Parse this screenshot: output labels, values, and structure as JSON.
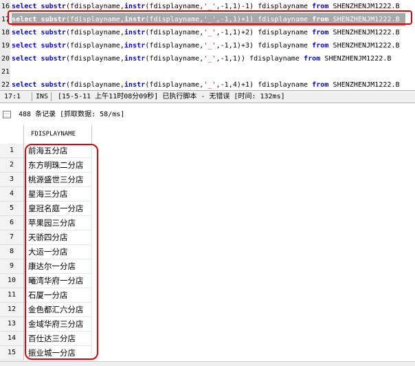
{
  "editor": {
    "lines": [
      {
        "num": "16",
        "selected": false,
        "tokens": [
          [
            "kw",
            "select"
          ],
          [
            "t",
            " "
          ],
          [
            "kw",
            "substr"
          ],
          [
            "t",
            "(fdisplayname,"
          ],
          [
            "kw",
            "instr"
          ],
          [
            "t",
            "(fdisplayname,"
          ],
          [
            "str",
            "'_'"
          ],
          [
            "t",
            ",-1,1)-1) fdisplayname "
          ],
          [
            "kw",
            "from"
          ],
          [
            "t",
            " SHENZHENJM1222.B"
          ]
        ]
      },
      {
        "num": "17",
        "selected": true,
        "tokens": [
          [
            "kw",
            "select"
          ],
          [
            "t",
            " "
          ],
          [
            "kw",
            "substr"
          ],
          [
            "t",
            "(fdisplayname,"
          ],
          [
            "kw",
            "instr"
          ],
          [
            "t",
            "(fdisplayname,"
          ],
          [
            "str",
            "'_'"
          ],
          [
            "t",
            ",-1,1)+1) fdisplayname "
          ],
          [
            "kw",
            "from"
          ],
          [
            "t",
            " SHENZHENJM1222.B"
          ]
        ]
      },
      {
        "num": "18",
        "selected": false,
        "tokens": [
          [
            "kw",
            "select"
          ],
          [
            "t",
            " "
          ],
          [
            "kw",
            "substr"
          ],
          [
            "t",
            "(fdisplayname,"
          ],
          [
            "kw",
            "instr"
          ],
          [
            "t",
            "(fdisplayname,"
          ],
          [
            "str",
            "'_'"
          ],
          [
            "t",
            ",-1,1)+2) fdisplayname "
          ],
          [
            "kw",
            "from"
          ],
          [
            "t",
            " SHENZHENJM1222.B"
          ]
        ]
      },
      {
        "num": "19",
        "selected": false,
        "tokens": [
          [
            "kw",
            "select"
          ],
          [
            "t",
            " "
          ],
          [
            "kw",
            "substr"
          ],
          [
            "t",
            "(fdisplayname,"
          ],
          [
            "kw",
            "instr"
          ],
          [
            "t",
            "(fdisplayname,"
          ],
          [
            "str",
            "'_'"
          ],
          [
            "t",
            ",-1,1)+3) fdisplayname "
          ],
          [
            "kw",
            "from"
          ],
          [
            "t",
            " SHENZHENJM1222.B"
          ]
        ]
      },
      {
        "num": "20",
        "selected": false,
        "tokens": [
          [
            "kw",
            "select"
          ],
          [
            "t",
            " "
          ],
          [
            "kw",
            "substr"
          ],
          [
            "t",
            "(fdisplayname,"
          ],
          [
            "kw",
            "instr"
          ],
          [
            "t",
            "(fdisplayname,"
          ],
          [
            "str",
            "'_'"
          ],
          [
            "t",
            ",-1,1)) fdisplayname "
          ],
          [
            "kw",
            "from"
          ],
          [
            "t",
            " SHENZHENJM1222.B"
          ]
        ]
      },
      {
        "num": "21",
        "selected": false,
        "tokens": []
      },
      {
        "num": "22",
        "selected": false,
        "tokens": [
          [
            "kw",
            "select"
          ],
          [
            "t",
            " "
          ],
          [
            "kw",
            "substr"
          ],
          [
            "t",
            "(fdisplayname,"
          ],
          [
            "kw",
            "instr"
          ],
          [
            "t",
            "(fdisplayname,"
          ],
          [
            "str",
            "'_'"
          ],
          [
            "t",
            ",-1,4)+1) fdisplayname "
          ],
          [
            "kw",
            "from"
          ],
          [
            "t",
            " SHENZHENJM1222.B"
          ]
        ]
      }
    ]
  },
  "status": {
    "position": "17:1",
    "mode": "INS",
    "message": "[15-5-11 上午11时08分09秒] 已执行脚本 - 无错误  [时间: 132ms]"
  },
  "results": {
    "record_count": "488 条记录 [抓取数据: 58/ms]",
    "column_header": "FDISPLAYNAME",
    "rows": [
      {
        "num": "1",
        "value": "前海五分店"
      },
      {
        "num": "2",
        "value": "东方明珠二分店"
      },
      {
        "num": "3",
        "value": "桃源盛世三分店"
      },
      {
        "num": "4",
        "value": "星海三分店"
      },
      {
        "num": "5",
        "value": "皇冠名庭一分店"
      },
      {
        "num": "6",
        "value": "苹果园三分店"
      },
      {
        "num": "7",
        "value": "天骄四分店"
      },
      {
        "num": "8",
        "value": "大运一分店"
      },
      {
        "num": "9",
        "value": "康达尔一分店"
      },
      {
        "num": "10",
        "value": "曦湾华府一分店"
      },
      {
        "num": "11",
        "value": "石厦一分店"
      },
      {
        "num": "12",
        "value": "金色都汇六分店"
      },
      {
        "num": "13",
        "value": "金域华府三分店"
      },
      {
        "num": "14",
        "value": "百仕达三分店"
      },
      {
        "num": "15",
        "value": "振业城一分店"
      }
    ]
  },
  "colors": {
    "keyword": "#0000ee",
    "string": "#c80000",
    "highlight": "#e00000",
    "selection": "#a8a8a8"
  }
}
